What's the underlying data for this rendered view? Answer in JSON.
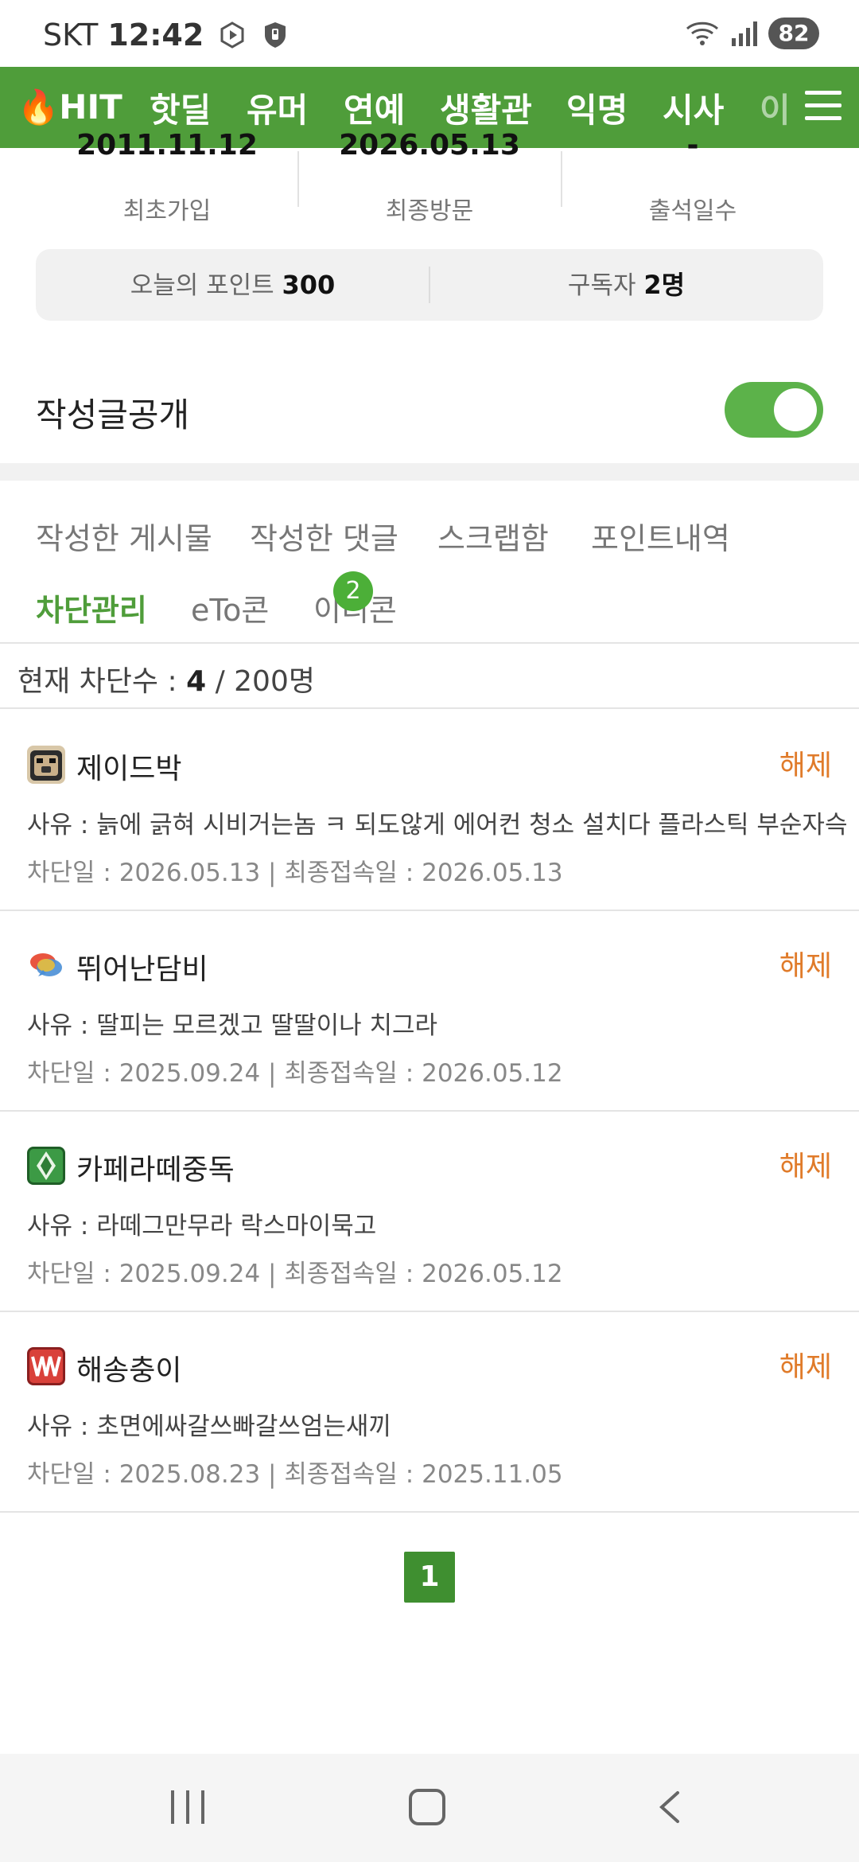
{
  "status_bar": {
    "carrier": "SKT",
    "time": "12:42",
    "battery": "82"
  },
  "nav": {
    "items": [
      "🔥HIT",
      "핫딜",
      "유머",
      "연예",
      "생활관",
      "익명",
      "시사",
      "이"
    ],
    "accent": "#4f9d3a"
  },
  "profile_stats": [
    {
      "value": "2011.11.12",
      "label": "최초가입"
    },
    {
      "value": "2026.05.13",
      "label": "최종방문"
    },
    {
      "value": "-",
      "label": "출석일수"
    }
  ],
  "points": {
    "today_label": "오늘의 포인트 ",
    "today_value": "300",
    "subs_label": "구독자 ",
    "subs_value": "2명"
  },
  "public_posts": {
    "label": "작성글공개",
    "on": true
  },
  "tabs": [
    {
      "label": "작성한 게시물"
    },
    {
      "label": "작성한 댓글"
    },
    {
      "label": "스크랩함"
    },
    {
      "label": "포인트내역"
    },
    {
      "label": "차단관리",
      "active": true
    },
    {
      "label": "eTo콘"
    },
    {
      "label": "이티콘",
      "badge": "2"
    }
  ],
  "block_count": {
    "prefix": "현재 차단수 : ",
    "current": "4",
    "suffix": " / 200명"
  },
  "blocked_users": [
    {
      "name": "제이드박",
      "reason": "사유 : 늙에 긁혀 시비거는놈 ㅋ 되도않게 에어컨 청소 설치다 플라스틱 부순자슥",
      "dates": "차단일 : 2026.05.13  |  최종접속일 : 2026.05.13",
      "unblock": "해제",
      "avatar": "pug-icon"
    },
    {
      "name": "뛰어난담비",
      "reason": "사유 : 딸피는 모르겠고 딸딸이나 치그라",
      "dates": "차단일 : 2025.09.24  |  최종접속일 : 2026.05.12",
      "unblock": "해제",
      "avatar": "speech-bubbles-icon"
    },
    {
      "name": "카페라떼중독",
      "reason": "사유 : 라떼그만무라 락스마이묵고",
      "dates": "차단일 : 2025.09.24  |  최종접속일 : 2026.05.12",
      "unblock": "해제",
      "avatar": "green-diamond-icon"
    },
    {
      "name": "해송충이",
      "reason": "사유 : 초면에싸갈쓰빠갈쓰엄는새끼",
      "dates": "차단일 : 2025.08.23  |  최종접속일 : 2025.11.05",
      "unblock": "해제",
      "avatar": "red-spikes-icon"
    }
  ],
  "pagination": {
    "current": "1"
  }
}
